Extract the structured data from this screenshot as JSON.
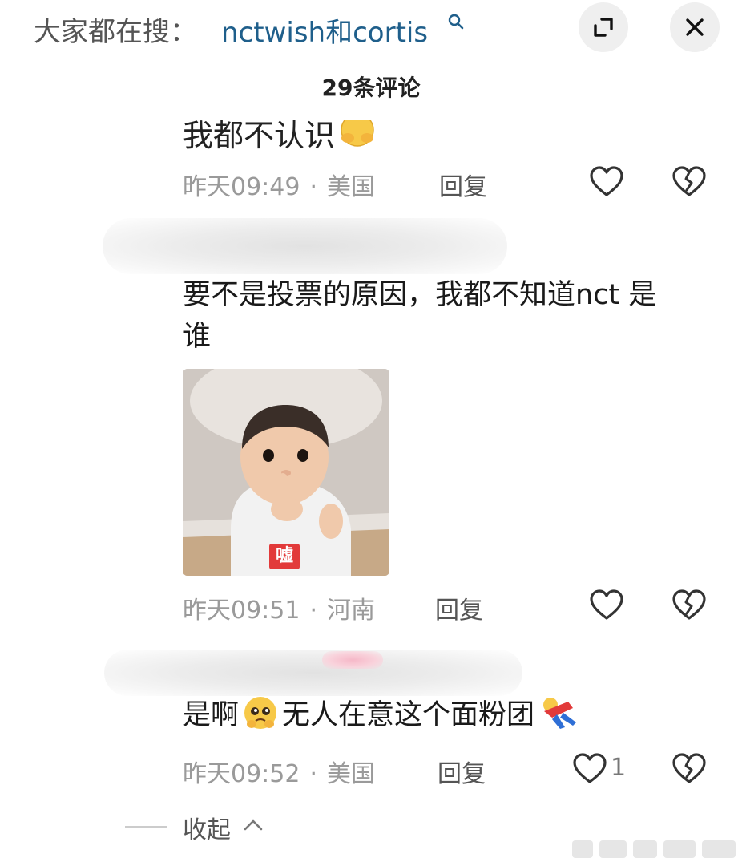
{
  "header": {
    "search_prefix": "大家都在搜：",
    "search_query": "nctwish和cortis",
    "title": "29条评论"
  },
  "comments": [
    {
      "text_cut": "我都不认识",
      "time": "昨天09:49",
      "separator": "·",
      "location": "美国",
      "reply": "回复",
      "likes": ""
    },
    {
      "text": "要不是投票的原因，我都不知道nct 是谁",
      "text_line1": "要不是投票的原因，我都不知道nct 是",
      "text_line2": "谁",
      "sticker_label": "嘘",
      "time": "昨天09:51",
      "separator": "·",
      "location": "河南",
      "reply": "回复",
      "likes": ""
    },
    {
      "text_part1": "是啊",
      "text_part2": "无人在意这个面粉团",
      "time": "昨天09:52",
      "separator": "·",
      "location": "美国",
      "reply": "回复",
      "likes": "1"
    }
  ],
  "footer": {
    "collapse": "收起"
  },
  "icons": {
    "search": "search-icon",
    "expand": "expand-icon",
    "close": "close-icon",
    "like": "heart-outline-icon",
    "dislike": "broken-heart-icon",
    "collapse": "chevron-up-icon"
  },
  "colors": {
    "link_blue": "#1f5f8b",
    "meta_gray": "#9a9a9a",
    "sticker_red": "#e23a3a"
  }
}
